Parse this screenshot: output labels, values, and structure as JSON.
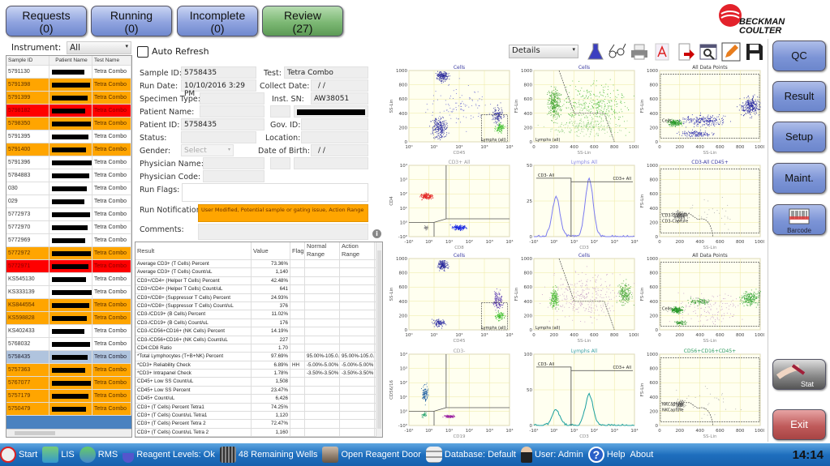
{
  "tabs": [
    {
      "label": "Requests",
      "count": "(0)"
    },
    {
      "label": "Running",
      "count": "(0)"
    },
    {
      "label": "Incomplete",
      "count": "(0)"
    },
    {
      "label": "Review",
      "count": "(27)"
    }
  ],
  "instrument": {
    "label": "Instrument:",
    "value": "All"
  },
  "auto_refresh": {
    "label": "Auto Refresh",
    "checked": false
  },
  "sample_list": {
    "headers": [
      "Sample ID",
      "Patient Name",
      "Test Name"
    ],
    "rows": [
      {
        "id": "5791130",
        "test": "Tetra Combo",
        "status": "w"
      },
      {
        "id": "5791398",
        "test": "Tetra Combo",
        "status": "o"
      },
      {
        "id": "5791399",
        "test": "Tetra Combo",
        "status": "o"
      },
      {
        "id": "5798182",
        "test": "Tetra Combo",
        "status": "r"
      },
      {
        "id": "5798350",
        "test": "Tetra Combo",
        "status": "o"
      },
      {
        "id": "5791395",
        "test": "Tetra Combo",
        "status": "w"
      },
      {
        "id": "5791400",
        "test": "Tetra Combo",
        "status": "o"
      },
      {
        "id": "5791396",
        "test": "Tetra Combo",
        "status": "w"
      },
      {
        "id": "5784883",
        "test": "Tetra Combo",
        "status": "w"
      },
      {
        "id": "030",
        "test": "Tetra Combo",
        "status": "w"
      },
      {
        "id": "029",
        "test": "Tetra Combo",
        "status": "w"
      },
      {
        "id": "5772973",
        "test": "Tetra Combo",
        "status": "w"
      },
      {
        "id": "5772970",
        "test": "Tetra Combo",
        "status": "w"
      },
      {
        "id": "5772969",
        "test": "Tetra Combo",
        "status": "w"
      },
      {
        "id": "5772972",
        "test": "Tetra Combo",
        "status": "o"
      },
      {
        "id": "5772971",
        "test": "Tetra Combo",
        "status": "r"
      },
      {
        "id": "KS545130",
        "test": "Tetra Combo",
        "status": "w"
      },
      {
        "id": "KS333139",
        "test": "Tetra Combo",
        "status": "w"
      },
      {
        "id": "KS844554",
        "test": "Tetra Combo",
        "status": "o"
      },
      {
        "id": "KS598828",
        "test": "Tetra Combo",
        "status": "o"
      },
      {
        "id": "KS402433",
        "test": "Tetra Combo",
        "status": "w"
      },
      {
        "id": "5768032",
        "test": "Tetra Combo",
        "status": "w"
      },
      {
        "id": "5758435",
        "test": "Tetra Combo",
        "status": "s"
      },
      {
        "id": "5757363",
        "test": "Tetra Combo",
        "status": "o"
      },
      {
        "id": "5767077",
        "test": "Tetra Combo",
        "status": "o"
      },
      {
        "id": "5757179",
        "test": "Tetra Combo",
        "status": "o"
      },
      {
        "id": "5750479",
        "test": "Tetra Combo",
        "status": "o"
      }
    ]
  },
  "details": {
    "sample_id_label": "Sample ID:",
    "sample_id": "5758435",
    "test_label": "Test:",
    "test": "Tetra Combo",
    "run_date_label": "Run Date:",
    "run_date": "10/10/2016 3:29 PM",
    "collect_date_label": "Collect Date:",
    "collect_date": "/ /",
    "specimen_type_label": "Specimen Type:",
    "inst_sn_label": "Inst. SN:",
    "inst_sn": "AW38051",
    "patient_name_label": "Patient Name:",
    "patient_id_label": "Patient ID:",
    "patient_id": "5758435",
    "gov_id_label": "Gov. ID:",
    "status_label": "Status:",
    "location_label": "Location:",
    "gender_label": "Gender:",
    "gender_placeholder": "Select",
    "dob_label": "Date of Birth:",
    "dob": "/ /",
    "physician_name_label": "Physician Name:",
    "physician_code_label": "Physician Code:",
    "run_flags_label": "Run Flags:",
    "run_notifications_label": "Run Notifications:",
    "run_notifications": "User Modified, Potential sample or gating issue, Action Range",
    "comments_label": "Comments:"
  },
  "results": {
    "headers": [
      "Result",
      "Value",
      "Flag",
      "Normal Range",
      "Action Range"
    ],
    "rows": [
      [
        "Average CD3+ (T Cells) Percent",
        "73.36%",
        "",
        "",
        ""
      ],
      [
        "Average CD3+ (T Cells) Count/uL",
        "1,140",
        "",
        "",
        ""
      ],
      [
        "CD3+/CD4+ (Helper T Cells) Percent",
        "42.48%",
        "",
        "",
        ""
      ],
      [
        "CD3+/CD4+ (Helper T Cells) Count/uL",
        "641",
        "",
        "",
        ""
      ],
      [
        "CD3+/CD8+ (Suppressor T Cells) Percent",
        "24.93%",
        "",
        "",
        ""
      ],
      [
        "CD3+/CD8+ (Suppressor T Cells) Count/uL",
        "376",
        "",
        "",
        ""
      ],
      [
        "CD3-/CD19+ (B Cells) Percent",
        "11.02%",
        "",
        "",
        ""
      ],
      [
        "CD3-/CD19+ (B Cells) Count/uL",
        "176",
        "",
        "",
        ""
      ],
      [
        "CD3-/CD56+CD16+ (NK Cells) Percent",
        "14.19%",
        "",
        "",
        ""
      ],
      [
        "CD3-/CD56+CD16+ (NK Cells) Count/uL",
        "227",
        "",
        "",
        ""
      ],
      [
        "CD4:CD8 Ratio",
        "1.70",
        "",
        "",
        ""
      ],
      [
        "*Total Lymphocytes (T+B+NK) Percent",
        "97.69%",
        "",
        "95.00%-105.0...",
        "95.00%-105.0..."
      ],
      [
        "*CD3+ Reliability Check",
        "6.89%",
        "HH",
        "-5.00%-5.00%",
        "-5.00%-5.00%"
      ],
      [
        "*CD3+ Intrapanel Check",
        "1.78%",
        "",
        "-3.50%-3.50%",
        "-3.50%-3.50%"
      ],
      [
        "CD45+ Low SS Count/uL",
        "1,508",
        "",
        "",
        ""
      ],
      [
        "CD45+ Low SS Percent",
        "23.47%",
        "",
        "",
        ""
      ],
      [
        "CD45+ Count/uL",
        "6,426",
        "",
        "",
        ""
      ],
      [
        "CD3+ (T Cells) Percent Tetra1",
        "74.25%",
        "",
        "",
        ""
      ],
      [
        "CD3+ (T Cells) Count/uL Tetra1",
        "1,120",
        "",
        "",
        ""
      ],
      [
        "CD3+ (T Cells) Percent Tetra 2",
        "72.47%",
        "",
        "",
        ""
      ],
      [
        "CD3+ (T Cells) Count/uL Tetra 2",
        "1,160",
        "",
        "",
        ""
      ]
    ]
  },
  "toolbar": {
    "view_select": "Details",
    "icons": [
      "flask-icon",
      "glasses-icon",
      "printer-icon",
      "pdf-icon",
      "export-icon",
      "preview-icon",
      "edit-pencil-icon",
      "save-floppy-icon"
    ]
  },
  "logo": {
    "line1": "BECKMAN",
    "line2": "COULTER"
  },
  "side_buttons": [
    "QC",
    "Result",
    "Setup",
    "Maint.",
    "Barcode",
    "Stat",
    "Exit"
  ],
  "plots": [
    {
      "title": "Cells",
      "title_color": "#3a3aa0",
      "xlabel": "CD45",
      "ylabel": "SS-Lin",
      "xticks": [
        "10⁰",
        "10¹",
        "10²",
        "10³",
        "10⁴"
      ],
      "yticks": [
        "0",
        "200",
        "400",
        "600",
        "800",
        "1000"
      ],
      "gates": [
        "Lymphs (all)"
      ]
    },
    {
      "title": "Cells",
      "title_color": "#3a3aa0",
      "xlabel": "SS-Lin",
      "ylabel": "FS-Lin",
      "xticks": [
        "0",
        "200",
        "400",
        "600",
        "800",
        "1000"
      ],
      "yticks": [
        "0",
        "200",
        "400",
        "600",
        "800",
        "1000"
      ],
      "gates": [
        "Lymphs (all)"
      ]
    },
    {
      "title": "All Data Points",
      "title_color": "#333",
      "xlabel": "SS-Lin",
      "ylabel": "FS-Lin",
      "xticks": [
        "0",
        "200",
        "400",
        "600",
        "800",
        "1000"
      ],
      "yticks": [
        "0",
        "200",
        "400",
        "600",
        "800",
        "1000"
      ],
      "gates": [
        "Cells"
      ]
    },
    {
      "title": "CD3+ All",
      "title_color": "#999",
      "xlabel": "CD8",
      "ylabel": "CD4",
      "xticks": [
        "-10¹",
        "10⁰",
        "10¹",
        "10²",
        "10³",
        "10⁴"
      ],
      "yticks": [
        "-10⁰",
        "10⁰",
        "10¹",
        "10²",
        "10³",
        "10⁴"
      ],
      "gates": []
    },
    {
      "title": "Lymphs All",
      "title_color": "#8a8ae0",
      "xlabel": "CD3",
      "ylabel": "",
      "xticks": [
        "-10¹",
        "10⁰",
        "10¹",
        "10²",
        "10³",
        "10⁴"
      ],
      "yticks": [
        "0",
        "25",
        "50"
      ],
      "gates": [
        "CD3- All",
        "CD3+ All"
      ]
    },
    {
      "title": "CD3-All CD45+",
      "title_color": "#3a3aa0",
      "xlabel": "SS-Lin",
      "ylabel": "FS-Lin",
      "xticks": [
        "0",
        "200",
        "400",
        "600",
        "800",
        "1000"
      ],
      "yticks": [
        "0",
        "200",
        "400",
        "600",
        "800",
        "1000"
      ],
      "gates": [
        "CD3-Capture"
      ]
    },
    {
      "title": "Cells",
      "title_color": "#3a3aa0",
      "xlabel": "CD45",
      "ylabel": "SS-Lin",
      "xticks": [
        "10⁰",
        "10¹",
        "10²",
        "10³",
        "10⁴"
      ],
      "yticks": [
        "0",
        "200",
        "400",
        "600",
        "800",
        "1000"
      ],
      "gates": [
        "Lymphs (all)"
      ]
    },
    {
      "title": "Cells",
      "title_color": "#3a3aa0",
      "xlabel": "SS-Lin",
      "ylabel": "FS-Lin",
      "xticks": [
        "0",
        "200",
        "400",
        "600",
        "800",
        "1000"
      ],
      "yticks": [
        "0",
        "200",
        "400",
        "600",
        "800",
        "1000"
      ],
      "gates": [
        "Lymphs (all)"
      ]
    },
    {
      "title": "All Data Points",
      "title_color": "#333",
      "xlabel": "SS-Lin",
      "ylabel": "FS-Lin",
      "xticks": [
        "0",
        "200",
        "400",
        "600",
        "800",
        "1000"
      ],
      "yticks": [
        "0",
        "200",
        "400",
        "600",
        "800",
        "1000"
      ],
      "gates": [
        "Cells"
      ]
    },
    {
      "title": "CD3-",
      "title_color": "#999",
      "xlabel": "CD19",
      "ylabel": "CD56/16",
      "xticks": [
        "-10¹",
        "10⁰",
        "10¹",
        "10²",
        "10³",
        "10⁴"
      ],
      "yticks": [
        "-10⁰",
        "10⁰",
        "10¹",
        "10²",
        "10³",
        "10⁴"
      ],
      "gates": []
    },
    {
      "title": "Lymphs All",
      "title_color": "#3aa0a0",
      "xlabel": "CD3",
      "ylabel": "",
      "xticks": [
        "-10¹",
        "10⁰",
        "10¹",
        "10²",
        "10³",
        "10⁴"
      ],
      "yticks": [
        "0",
        "50",
        "100"
      ],
      "gates": [
        "CD3- All",
        "CD3+ All"
      ]
    },
    {
      "title": "CD56+CD16+CD45+",
      "title_color": "#2a9a5a",
      "xlabel": "SS-Lin",
      "ylabel": "FS-Lin",
      "xticks": [
        "0",
        "200",
        "400",
        "600",
        "800",
        "1000"
      ],
      "yticks": [
        "0",
        "200",
        "400",
        "600",
        "800",
        "1000"
      ],
      "gates": [
        "NKCapture"
      ]
    }
  ],
  "status_bar": {
    "items": [
      "Start",
      "LIS",
      "RMS",
      "Reagent Levels: Ok",
      "48 Remaining Wells",
      "Open Reagent Door",
      "Database: Default",
      "User: Admin",
      "Help",
      "About"
    ],
    "time": "14:14"
  }
}
